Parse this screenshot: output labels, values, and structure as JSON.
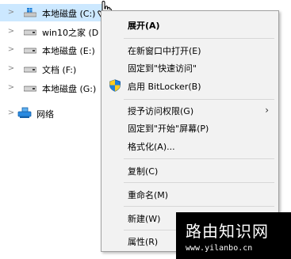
{
  "tree": {
    "items": [
      {
        "label": "本地磁盘 (C:)",
        "icon": "windows-drive-icon",
        "selected": true
      },
      {
        "label": "win10之家 (D",
        "icon": "drive-icon",
        "selected": false
      },
      {
        "label": "本地磁盘 (E:)",
        "icon": "drive-icon",
        "selected": false
      },
      {
        "label": "文档 (F:)",
        "icon": "drive-icon",
        "selected": false
      },
      {
        "label": "本地磁盘 (G:)",
        "icon": "drive-icon",
        "selected": false
      },
      {
        "label": "网络",
        "icon": "network-icon",
        "selected": false
      }
    ]
  },
  "context_menu": {
    "items": [
      {
        "label": "展开(A)",
        "bold": true
      },
      {
        "label": "在新窗口中打开(E)"
      },
      {
        "label": "固定到\"快速访问\""
      },
      {
        "label": "启用 BitLocker(B)",
        "icon": "shield-icon"
      },
      {
        "label": "授予访问权限(G)",
        "submenu": true
      },
      {
        "label": "固定到\"开始\"屏幕(P)"
      },
      {
        "label": "格式化(A)..."
      },
      {
        "label": "复制(C)"
      },
      {
        "label": "重命名(M)"
      },
      {
        "label": "新建(W)",
        "submenu": true
      },
      {
        "label": "属性(R)"
      }
    ],
    "submenu_arrow": "›"
  },
  "watermark": {
    "title": "路由知识网",
    "url": "www.yilanbo.cn"
  },
  "colors": {
    "selection": "#cce8ff",
    "menu_bg": "#f2f2f2",
    "menu_border": "#a0a0a0",
    "network_blue": "#1e7fd8"
  }
}
